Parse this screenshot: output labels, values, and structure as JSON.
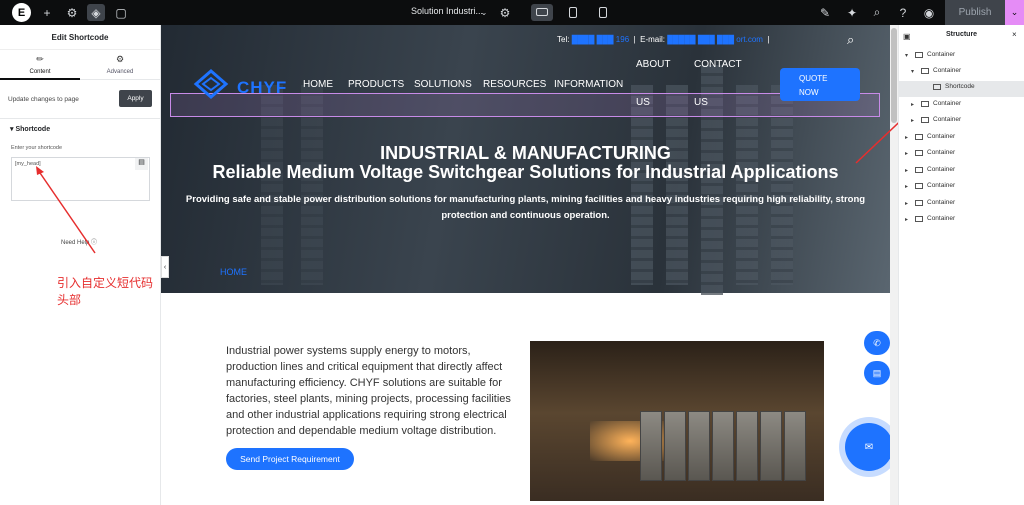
{
  "topbar": {
    "logo": "E",
    "page_title": "Solution Industri...",
    "publish_label": "Publish"
  },
  "left_panel": {
    "title": "Edit Shortcode",
    "tab_content": "Content",
    "tab_advanced": "Advanced",
    "update_text": "Update changes to page",
    "apply_label": "Apply",
    "section_label": "Shortcode",
    "enter_label": "Enter your shortcode",
    "shortcode_value": "[my_head]",
    "help_label": "Need Help",
    "annotation": "引入自定义短代码头部"
  },
  "site": {
    "tel_label": "Tel:",
    "email_label": "E-mail:",
    "brand": "CHYF",
    "nav": [
      "HOME",
      "PRODUCTS",
      "SOLUTIONS",
      "RESOURCES",
      "INFORMATION"
    ],
    "nav_about": [
      "ABOUT",
      "US"
    ],
    "nav_contact": [
      "CONTACT",
      "US"
    ],
    "quote": [
      "QUOTE",
      "NOW"
    ],
    "hero_title_1": "INDUSTRIAL & MANUFACTURING",
    "hero_title_2": "Reliable Medium Voltage Switchgear Solutions for Industrial Applications",
    "hero_sub_1": "Providing safe and stable power distribution solutions for manufacturing plants, mining facilities and heavy industries requiring high reliability, strong",
    "hero_sub_2": "protection and continuous operation.",
    "breadcrumb": "HOME",
    "body_text": "Industrial power systems supply energy to motors, production lines and critical equipment that directly affect manufacturing efficiency. CHYF solutions are suitable for factories, steel plants, mining projects, processing facilities and other industrial applications requiring strong electrical protection and dependable medium voltage distribution.",
    "cta": "Send Project Requirement"
  },
  "structure": {
    "title": "Structure",
    "items": [
      "Container",
      "Container",
      "Shortcode",
      "Container",
      "Container",
      "Container",
      "Container",
      "Container",
      "Container",
      "Container",
      "Container"
    ]
  },
  "colors": {
    "accent": "#1e73ff",
    "annotation": "#e62e2e",
    "publish_pink": "#e58cf6"
  }
}
